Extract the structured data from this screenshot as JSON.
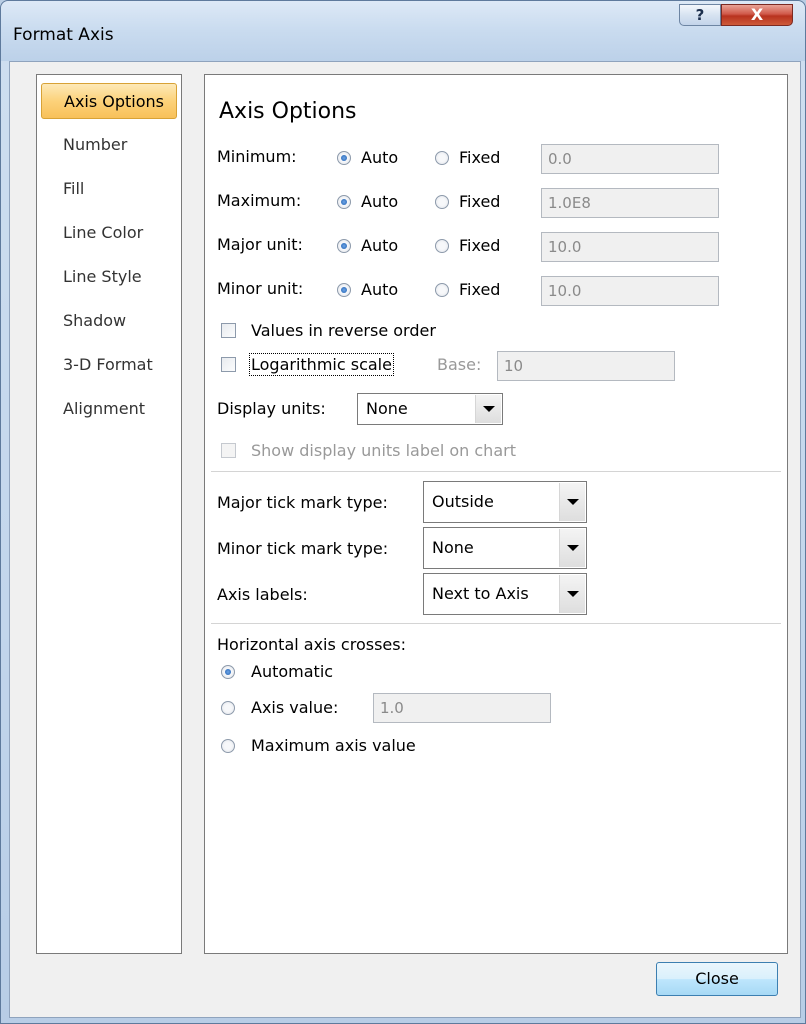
{
  "window": {
    "title": "Format Axis",
    "help_label": "?",
    "close_label": "X"
  },
  "sidebar": {
    "items": [
      {
        "label": "Axis Options",
        "selected": true
      },
      {
        "label": "Number"
      },
      {
        "label": "Fill"
      },
      {
        "label": "Line Color"
      },
      {
        "label": "Line Style"
      },
      {
        "label": "Shadow"
      },
      {
        "label": "3-D Format"
      },
      {
        "label": "Alignment"
      }
    ]
  },
  "axis_options": {
    "heading": "Axis Options",
    "rows": [
      {
        "label": "Minimum:",
        "auto_label": "Auto",
        "fixed_label": "Fixed",
        "selected": "auto",
        "value": "0.0"
      },
      {
        "label": "Maximum:",
        "auto_label": "Auto",
        "fixed_label": "Fixed",
        "selected": "auto",
        "value": "1.0E8"
      },
      {
        "label": "Major unit:",
        "auto_label": "Auto",
        "fixed_label": "Fixed",
        "selected": "auto",
        "value": "10.0"
      },
      {
        "label": "Minor unit:",
        "auto_label": "Auto",
        "fixed_label": "Fixed",
        "selected": "auto",
        "value": "10.0"
      }
    ],
    "reverse_order": {
      "label": "Values in reverse order",
      "checked": false
    },
    "log_scale": {
      "label": "Logarithmic scale",
      "checked": false,
      "base_label": "Base:",
      "base_value": "10"
    },
    "display_units": {
      "label": "Display units:",
      "value": "None"
    },
    "show_units_label": {
      "label": "Show display units label on chart",
      "checked": false,
      "enabled": false
    },
    "major_tick": {
      "label": "Major tick mark type:",
      "value": "Outside"
    },
    "minor_tick": {
      "label": "Minor tick mark type:",
      "value": "None"
    },
    "axis_labels": {
      "label": "Axis labels:",
      "value": "Next to Axis"
    },
    "crosses": {
      "heading": "Horizontal axis crosses:",
      "selected": "automatic",
      "automatic_label": "Automatic",
      "axis_value_label": "Axis value:",
      "axis_value": "1.0",
      "maximum_label": "Maximum axis value"
    }
  },
  "footer": {
    "close_label": "Close"
  },
  "colors": {
    "selection": "#fcd27a",
    "radio_on": "#1f5fb0"
  }
}
